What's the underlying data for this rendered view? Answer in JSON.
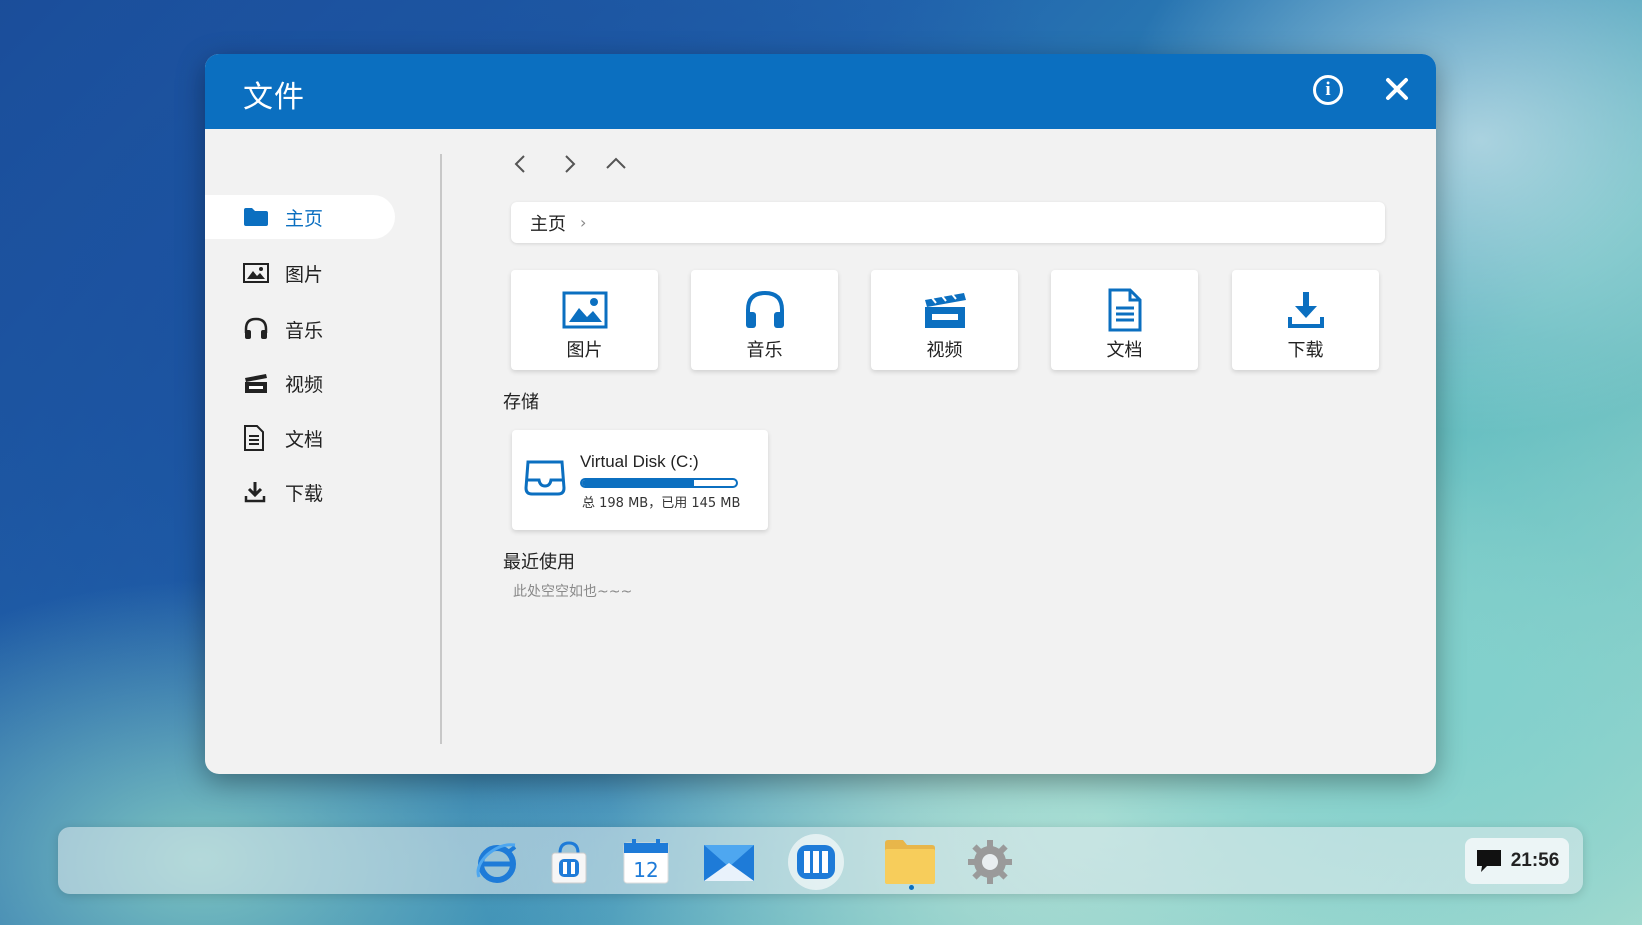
{
  "window": {
    "title": "文件",
    "accent_color": "#0b6fc0"
  },
  "sidebar": {
    "items": [
      {
        "label": "主页",
        "icon": "folder-icon",
        "active": true
      },
      {
        "label": "图片",
        "icon": "image-icon",
        "active": false
      },
      {
        "label": "音乐",
        "icon": "headphones-icon",
        "active": false
      },
      {
        "label": "视频",
        "icon": "clapperboard-icon",
        "active": false
      },
      {
        "label": "文档",
        "icon": "document-icon",
        "active": false
      },
      {
        "label": "下载",
        "icon": "download-icon",
        "active": false
      }
    ]
  },
  "navigation": {
    "back_icon": "chevron-left-icon",
    "forward_icon": "chevron-right-icon",
    "up_icon": "chevron-up-icon"
  },
  "breadcrumb": {
    "current": "主页",
    "separator": "›"
  },
  "quick_access": [
    {
      "label": "图片",
      "icon": "image-icon"
    },
    {
      "label": "音乐",
      "icon": "headphones-icon"
    },
    {
      "label": "视频",
      "icon": "clapperboard-icon"
    },
    {
      "label": "文档",
      "icon": "document-icon"
    },
    {
      "label": "下载",
      "icon": "download-icon"
    }
  ],
  "storage": {
    "heading": "存储",
    "disks": [
      {
        "name": "Virtual Disk (C:)",
        "info": "总 198 MB，已用 145 MB",
        "used_fraction": 0.73
      }
    ]
  },
  "recent": {
    "heading": "最近使用",
    "empty_text": "此处空空如也~~~"
  },
  "taskbar": {
    "apps": [
      {
        "name": "browser",
        "icon": "browser-icon"
      },
      {
        "name": "store",
        "icon": "store-bag-icon"
      },
      {
        "name": "calendar",
        "icon": "calendar-icon",
        "label": "12"
      },
      {
        "name": "mail",
        "icon": "mail-icon"
      },
      {
        "name": "launcher",
        "icon": "launcher-icon"
      },
      {
        "name": "files",
        "icon": "folder-icon",
        "running": true
      },
      {
        "name": "settings",
        "icon": "gear-icon"
      }
    ],
    "clock": "21:56",
    "notification_icon": "chat-bubble-icon"
  }
}
